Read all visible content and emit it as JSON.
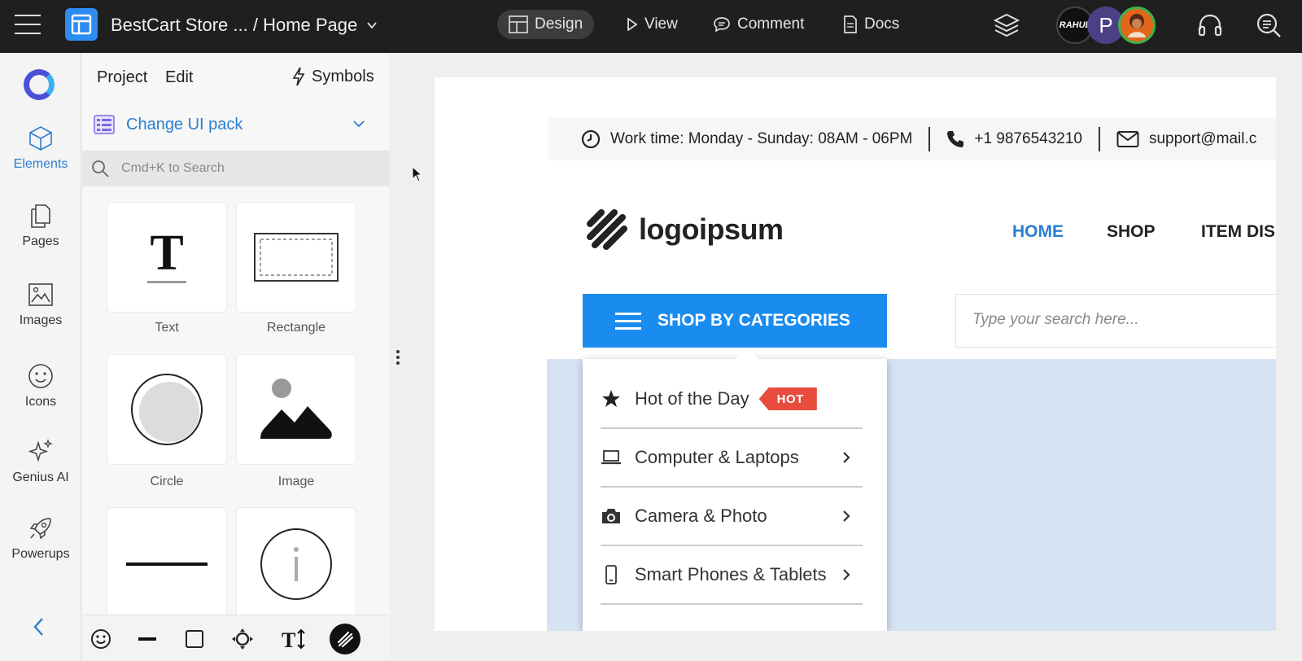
{
  "topbar": {
    "title": "BestCart Store ... / Home Page",
    "modes": [
      {
        "label": "Design",
        "active": true
      },
      {
        "label": "View",
        "active": false
      },
      {
        "label": "Comment",
        "active": false
      },
      {
        "label": "Docs",
        "active": false
      }
    ],
    "avatars": [
      {
        "initials": "RAHUL"
      },
      {
        "initials": "P"
      },
      {
        "initials": ""
      }
    ]
  },
  "rail": {
    "items": [
      {
        "label": "Elements",
        "icon": "cube-icon",
        "active": true
      },
      {
        "label": "Pages",
        "icon": "pages-icon"
      },
      {
        "label": "Images",
        "icon": "image-icon"
      },
      {
        "label": "Icons",
        "icon": "smiley-icon"
      },
      {
        "label": "Genius AI",
        "icon": "sparkle-icon"
      },
      {
        "label": "Powerups",
        "icon": "rocket-icon"
      }
    ]
  },
  "panel": {
    "tabs": [
      "Project",
      "Edit"
    ],
    "symbols_label": "Symbols",
    "ui_pack_label": "Change UI pack",
    "search_placeholder": "Cmd+K to Search",
    "tiles": [
      {
        "label": "Text"
      },
      {
        "label": "Rectangle"
      },
      {
        "label": "Circle"
      },
      {
        "label": "Image"
      }
    ]
  },
  "canvas": {
    "infobar": {
      "hours": "Work time: Monday - Sunday: 08AM - 06PM",
      "phone": "+1 9876543210",
      "email": "support@mail.c"
    },
    "logo_text": "logoipsum",
    "nav": [
      "HOME",
      "SHOP",
      "ITEM DIS"
    ],
    "categories_button": "SHOP BY CATEGORIES",
    "search_placeholder": "Type your search here...",
    "categories": [
      {
        "label": "Hot of the Day",
        "badge": "HOT"
      },
      {
        "label": "Computer & Laptops"
      },
      {
        "label": "Camera & Photo"
      },
      {
        "label": "Smart Phones & Tablets"
      }
    ]
  },
  "colors": {
    "accent": "#2a7ed1",
    "category_button": "#1a8cf0",
    "hot_badge": "#e84c3d",
    "hero": "#d5e3f3",
    "topbar": "#1f1f1f"
  }
}
